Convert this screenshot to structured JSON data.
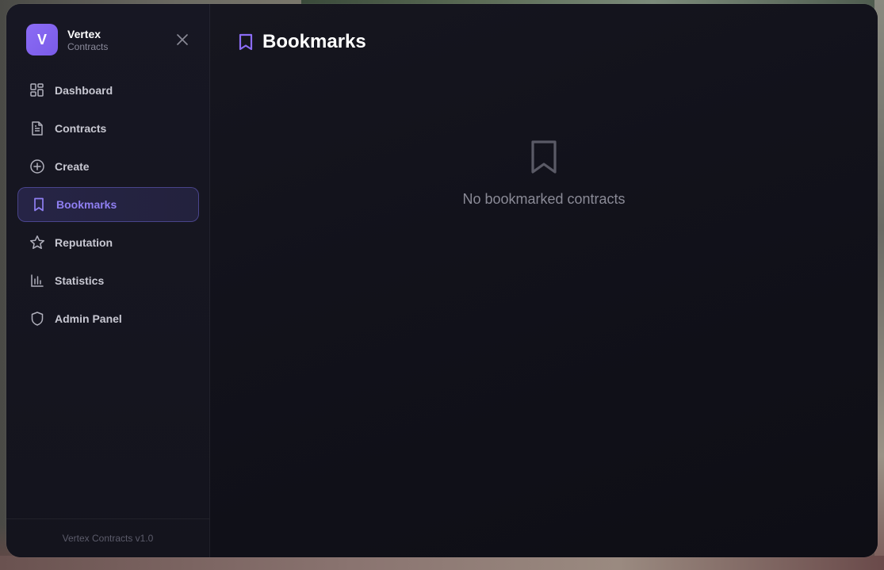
{
  "brand": {
    "logo_letter": "V",
    "name": "Vertex",
    "subtitle": "Contracts"
  },
  "nav": {
    "items": [
      {
        "label": "Dashboard",
        "icon": "dashboard-icon",
        "active": false
      },
      {
        "label": "Contracts",
        "icon": "document-icon",
        "active": false
      },
      {
        "label": "Create",
        "icon": "plus-circle-icon",
        "active": false
      },
      {
        "label": "Bookmarks",
        "icon": "bookmark-icon",
        "active": true
      },
      {
        "label": "Reputation",
        "icon": "star-icon",
        "active": false
      },
      {
        "label": "Statistics",
        "icon": "bar-chart-icon",
        "active": false
      },
      {
        "label": "Admin Panel",
        "icon": "shield-icon",
        "active": false
      }
    ]
  },
  "footer": {
    "version_text": "Vertex Contracts v1.0"
  },
  "main": {
    "title": "Bookmarks",
    "title_icon": "bookmark-icon",
    "empty_icon": "bookmark-icon",
    "empty_message": "No bookmarked contracts"
  },
  "colors": {
    "accent": "#8b6cf5",
    "active_text": "#8f7ff2",
    "background": "#12121a"
  }
}
